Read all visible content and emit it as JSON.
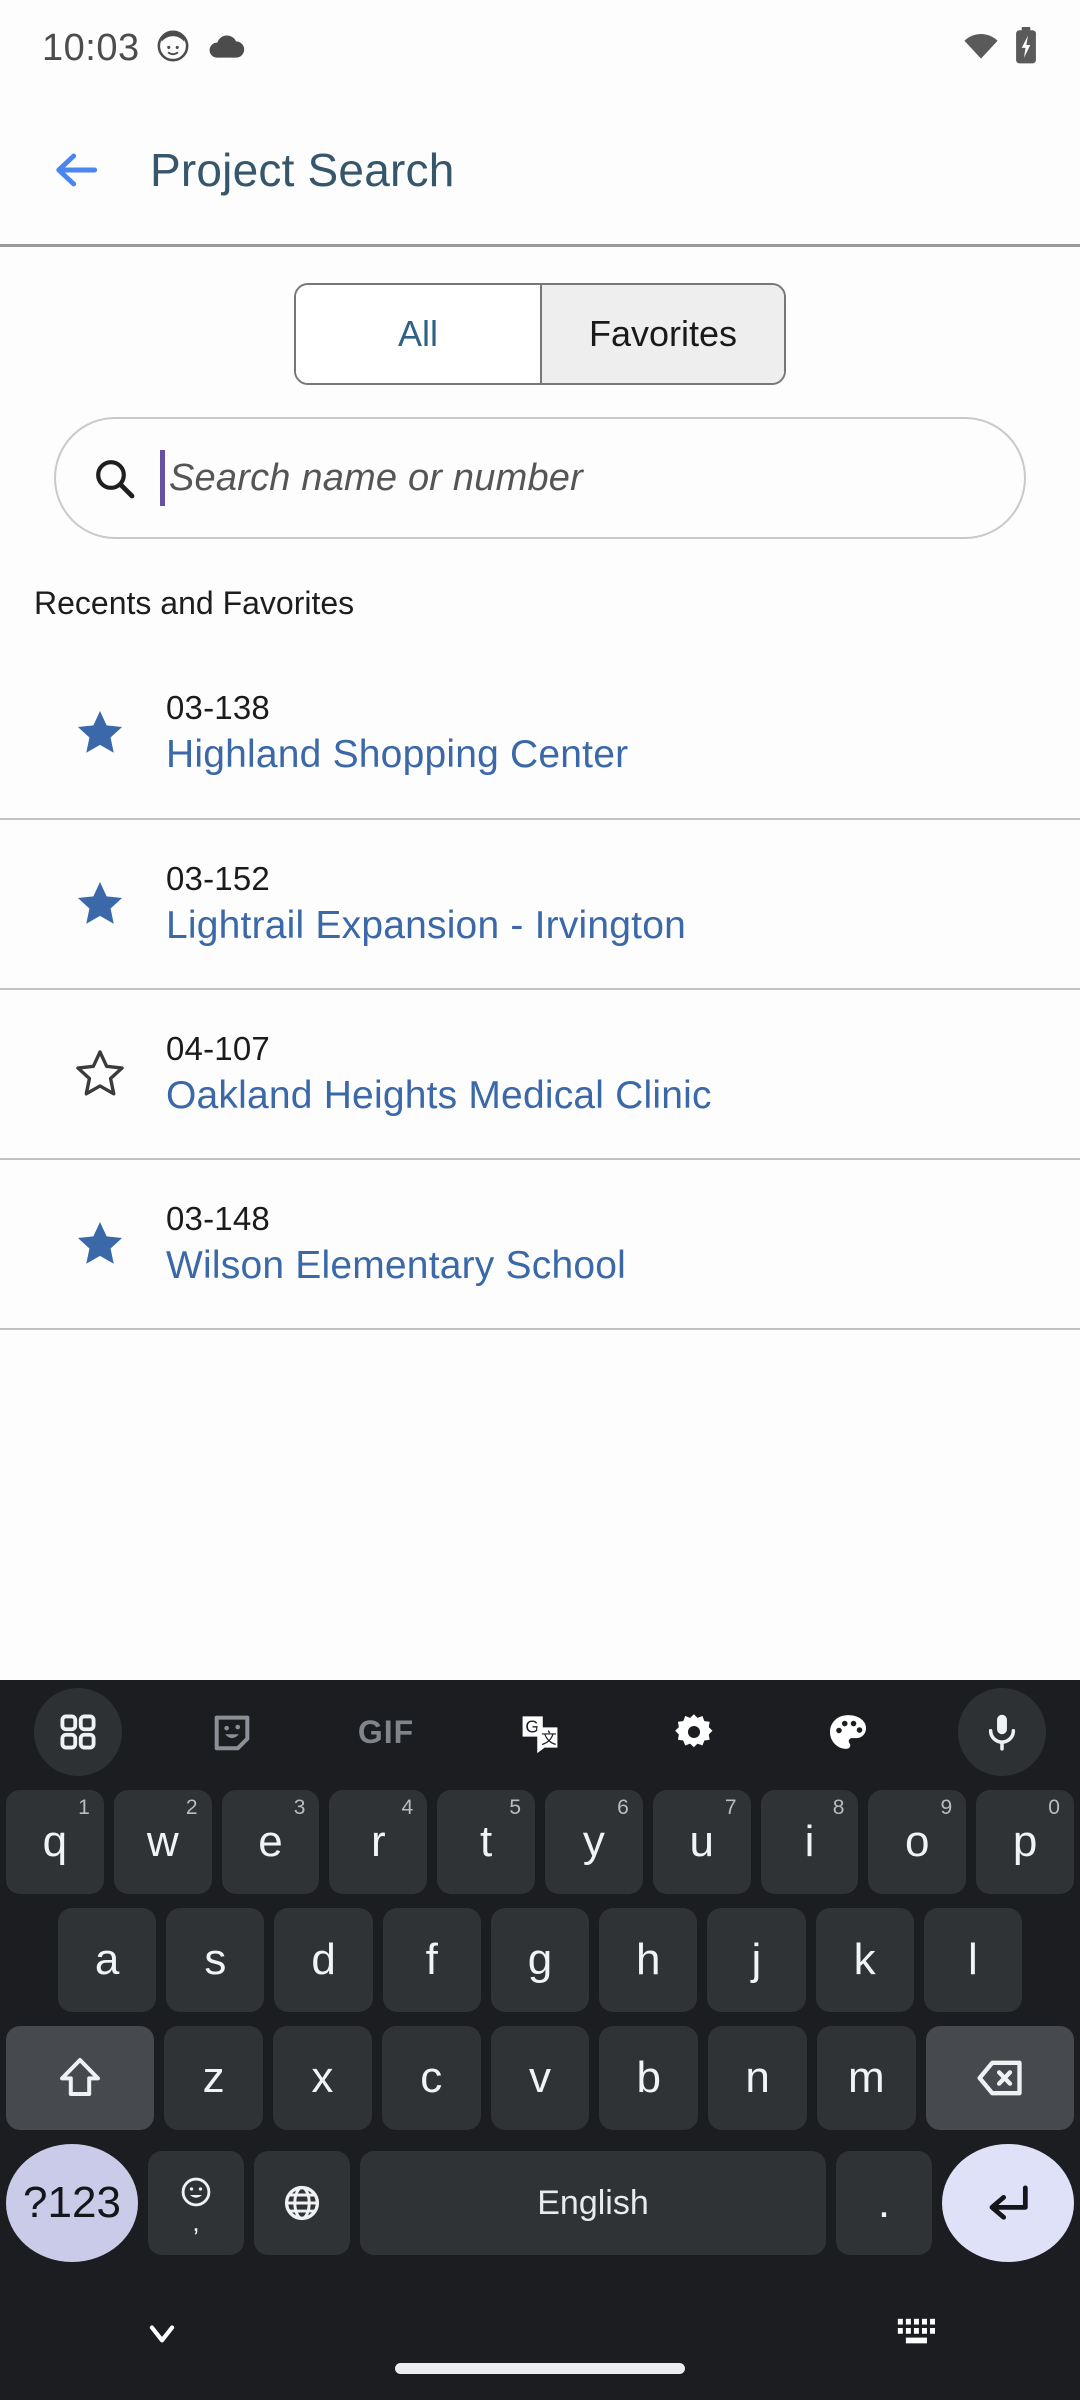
{
  "status_bar": {
    "time": "10:03",
    "left_icons": [
      "face-icon",
      "cloud-icon"
    ],
    "right_icons": [
      "wifi-icon",
      "battery-charging-icon"
    ]
  },
  "app_bar": {
    "back_label": "back-arrow",
    "title": "Project Search"
  },
  "segmented_control": {
    "options": [
      {
        "label": "All",
        "selected": false
      },
      {
        "label": "Favorites",
        "selected": true
      }
    ]
  },
  "search": {
    "value": "",
    "placeholder": "Search name or number",
    "icon": "search-icon"
  },
  "list": {
    "section_title": "Recents and Favorites",
    "rows": [
      {
        "number": "03-138",
        "name": "Highland Shopping Center",
        "favorite": true
      },
      {
        "number": "03-152",
        "name": "Lightrail Expansion - Irvington",
        "favorite": true
      },
      {
        "number": "04-107",
        "name": "Oakland Heights Medical Clinic",
        "favorite": false
      },
      {
        "number": "03-148",
        "name": "Wilson Elementary School",
        "favorite": true
      }
    ]
  },
  "keyboard": {
    "toolbar": [
      "grid-icon",
      "sticker-icon",
      "gif-icon",
      "translate-icon",
      "gear-icon",
      "palette-icon",
      "microphone-icon"
    ],
    "gif_label": "GIF",
    "row1": [
      {
        "letter": "q",
        "sup": "1"
      },
      {
        "letter": "w",
        "sup": "2"
      },
      {
        "letter": "e",
        "sup": "3"
      },
      {
        "letter": "r",
        "sup": "4"
      },
      {
        "letter": "t",
        "sup": "5"
      },
      {
        "letter": "y",
        "sup": "6"
      },
      {
        "letter": "u",
        "sup": "7"
      },
      {
        "letter": "i",
        "sup": "8"
      },
      {
        "letter": "o",
        "sup": "9"
      },
      {
        "letter": "p",
        "sup": "0"
      }
    ],
    "row2": [
      {
        "letter": "a"
      },
      {
        "letter": "s"
      },
      {
        "letter": "d"
      },
      {
        "letter": "f"
      },
      {
        "letter": "g"
      },
      {
        "letter": "h"
      },
      {
        "letter": "j"
      },
      {
        "letter": "k"
      },
      {
        "letter": "l"
      }
    ],
    "row3": [
      {
        "letter": "z"
      },
      {
        "letter": "x"
      },
      {
        "letter": "c"
      },
      {
        "letter": "v"
      },
      {
        "letter": "b"
      },
      {
        "letter": "n"
      },
      {
        "letter": "m"
      }
    ],
    "shift_label": "shift-icon",
    "backspace_label": "backspace-icon",
    "symbols_label": "?123",
    "emoji_label": "emoji-icon",
    "comma_label": ",",
    "globe_label": "globe-icon",
    "space_label": "English",
    "period_label": ".",
    "enter_label": "enter-icon",
    "nav_hide_label": "chevron-down-icon",
    "nav_switch_label": "keyboard-switch-icon"
  },
  "colors": {
    "accent_blue": "#3a68a8",
    "title_slate": "#35566b",
    "back_arrow_blue": "#4b86f0",
    "caret_purple": "#6750a4",
    "keyboard_bg": "#1b1d20",
    "key_bg": "#303336",
    "accent_key": "#c9cbe8"
  }
}
